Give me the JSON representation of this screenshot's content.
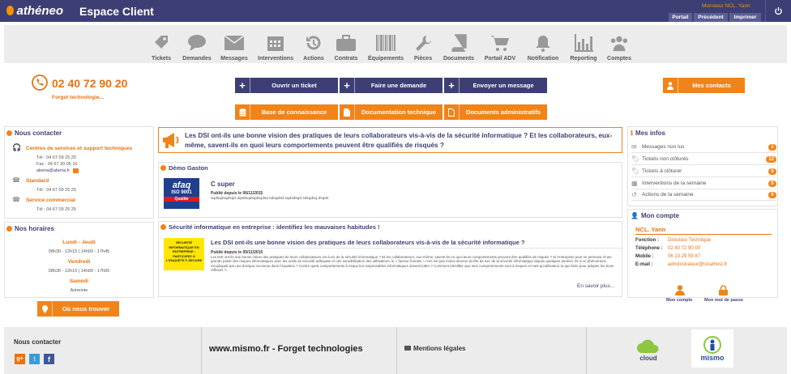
{
  "header": {
    "logo_text": "athéneo",
    "title": "Espace Client",
    "user": "Monsieur NCL. Yann",
    "tabs": [
      "Portail",
      "Précédent",
      "Imprimer"
    ]
  },
  "modules": [
    {
      "label": "Tickets",
      "icon": "ticket-icon"
    },
    {
      "label": "Demandes",
      "icon": "chat-icon"
    },
    {
      "label": "Messages",
      "icon": "envelope-icon"
    },
    {
      "label": "Interventions",
      "icon": "calendar-icon"
    },
    {
      "label": "Actions",
      "icon": "history-icon"
    },
    {
      "label": "Contrats",
      "icon": "briefcase-icon"
    },
    {
      "label": "Équipements",
      "icon": "barcode-icon"
    },
    {
      "label": "Pièces",
      "icon": "wrench-icon"
    },
    {
      "label": "Documents",
      "icon": "book-icon"
    },
    {
      "label": "Portail ADV",
      "icon": "cart-icon"
    },
    {
      "label": "Notification",
      "icon": "bell-icon"
    },
    {
      "label": "Reporting",
      "icon": "bar-chart-icon"
    },
    {
      "label": "Comptes",
      "icon": "users-icon"
    }
  ],
  "phone": {
    "number": "02 40 72 90 20",
    "company": "Forget technologie..."
  },
  "actions": {
    "open_ticket": "Ouvrir un ticket",
    "make_request": "Faire une demande",
    "send_message": "Envoyer un message",
    "my_contacts": "Mes contacts",
    "knowledge_base": "Base de connaissance",
    "tech_doc": "Documentation technique",
    "admin_docs": "Documents administratifs"
  },
  "contact": {
    "title": "Nous contacter",
    "centre_title": "Centres de services et support techniques",
    "centre_tel": "Tél :    04 67 09 25 25",
    "centre_fax": "Fax :    04 67 30 05 10",
    "centre_email": "aberia@aberia.fr",
    "standard_title": "Standard",
    "standard_tel": "Tél :    04 67 09 25 25",
    "commercial_title": "Service commercial",
    "commercial_tel": "Tél :    04 67 09 25 25"
  },
  "hours": {
    "title": "Nos horaires",
    "days1": "Lundi - Jeudi",
    "hours1": "08h30 - 12h15 | 14h00 - 17h45",
    "days2": "Vendredi",
    "hours2": "08h30 - 12h15 | 14h00 - 17h00",
    "days3": "Samedi",
    "hours3": "Astreinte",
    "find_us": "Où nous trouver"
  },
  "banner": "Les DSI ont-ils une bonne vision des pratiques de leurs collaborateurs vis-à-vis de la sécurité informatique ? Et les collaborateurs, eux-même, savent-ils en quoi leurs comportements peuvent être qualifiés de risqués ?",
  "news1": {
    "section": "Démo Gaston",
    "logo_text": "afaq",
    "logo_sub": "ISO 9001",
    "logo_caption": "Qualité",
    "title": "C super",
    "date": "Publié depuis le 06/11/2015",
    "body": "sqdsqdsqdsqd dqsdsqdsqdsqdsd sdsqdsd sqdsdsqd sdsqdsq dsqds"
  },
  "news2": {
    "section": "Sécurité informatique en entreprise : identifiez les mauvaises habitudes !",
    "logo_text": "SÉCURITÉ INFORMATIQUE EN ENTREPRISE : PARTICIPEZ À L'ENQUÊTE F-SECURE",
    "title": "Les DSI ont-ils une bonne vision des pratiques de leurs collaborateurs vis-à-vis de la sécurité informatique ?",
    "date": "Publié depuis le 05/11/2015",
    "body": "Les DSI ont-ils une bonne vision des pratiques de leurs collaborateurs vis-à-vis de la sécurité informatique ? Et les collaborateurs, eux-même, savent-ils en quoi leurs comportements peuvent être qualifiés de risqués ? Si l'entreprise peut se prémunir d'une grande partie des risques informatiques avec les outils de sécurité adéquate et une sensibilisation des utilisateurs, le « facteur humain » n'en est pas moins devenu la tête de turc de la sécurité informatique depuis quelques années. Et si ce phénomène s'expliquait par une doxique inconnue dans l'équation ? Contre quels comportements à risque les responsables informatiques doivent lutter ? Comment identifier que mes comportements sont à risques en tant qu'utilisateur et que faire pour adopter les bons réflexes ?...",
    "more": "En savoir plus..."
  },
  "infos": {
    "title": "Mes infos",
    "rows": [
      {
        "label": "Messages non lus",
        "count": "1"
      },
      {
        "label": "Tickets non clôturés",
        "count": "12"
      },
      {
        "label": "Tickets à clôturer",
        "count": "0"
      },
      {
        "label": "Interventions de la semaine",
        "count": "0"
      },
      {
        "label": "Actions de la semaine",
        "count": "0"
      }
    ]
  },
  "account": {
    "title": "Mon compte",
    "name": "NCL. Yann",
    "function_label": "Fonction :",
    "function": "Directeur Technique",
    "phone_label": "Téléphone :",
    "phone": "02 40 72 90 00",
    "mobile_label": "Mobile :",
    "mobile": "06 13 29 59 87",
    "email_label": "E-mail :",
    "email": "administrateur@localhost.fr",
    "btn_account": "Mon compte",
    "btn_password": "Mon mot de passe"
  },
  "footer": {
    "contact_title": "Nous contacter",
    "site": "www.mismo.fr  -  Forget technologies",
    "legal": "Mentions légales",
    "cloud_label": "cloud",
    "mismo_label": "mismo"
  },
  "colors": {
    "navy": "#3d3f74",
    "orange": "#f0841a"
  }
}
